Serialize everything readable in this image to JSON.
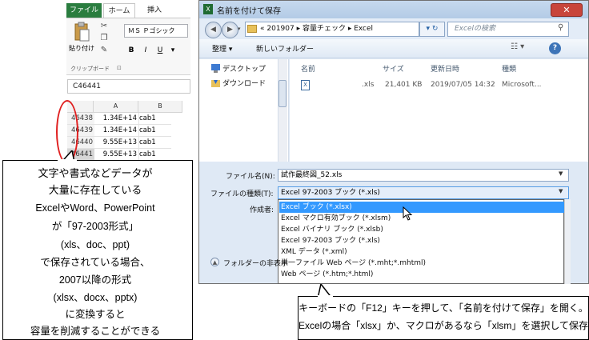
{
  "excel": {
    "tabs": {
      "file": "ファイル",
      "home": "ホーム",
      "insert": "挿入"
    },
    "paste_label": "貼り付け",
    "clipboard_label": "クリップボード",
    "clipboard_launcher": "⊡",
    "font_name": "ＭＳ Ｐゴシック",
    "bold": "B",
    "italic": "I",
    "underline": "U",
    "cell_reference": "C46441",
    "columns": [
      "A",
      "B"
    ],
    "rows": [
      {
        "num": "46438",
        "a": "1.34E+14",
        "b": "cab1"
      },
      {
        "num": "46439",
        "a": "1.34E+14",
        "b": "cab1"
      },
      {
        "num": "46440",
        "a": "9.55E+13",
        "b": "cab1"
      },
      {
        "num": "46441",
        "a": "9.55E+13",
        "b": "cab1"
      }
    ],
    "highlight_color": "#e02020"
  },
  "callout_left": {
    "lines": [
      "文字や書式などデータが",
      "大量に存在している",
      "ExcelやWord、PowerPoint",
      "が「97-2003形式」",
      "(xls、doc、ppt)",
      "で保存されている場合、",
      "2007以降の形式",
      "(xlsx、docx、pptx)",
      "に変換すると",
      "容量を削減することができる"
    ]
  },
  "dialog": {
    "title": "名前を付けて保存",
    "title_icon": "X",
    "close": "✕",
    "breadcrumb": "« 201907 ▸ 容量チェック ▸ Excel",
    "search_placeholder": "Excelの検索",
    "toolbar": {
      "organize": "整理 ▾",
      "new_folder": "新しいフォルダー",
      "view": "☷ ▾",
      "help": "?"
    },
    "nav_items": [
      "デスクトップ",
      "ダウンロード"
    ],
    "columns": {
      "name": "名前",
      "size": "サイズ",
      "modified": "更新日時",
      "type": "種類"
    },
    "file": {
      "ext": ".xls",
      "size": "21,401 KB",
      "modified": "2019/07/05 14:32",
      "type": "Microsoft..."
    },
    "filename_label": "ファイル名(N):",
    "filename_value": "試作最終図_52.xls",
    "filetype_label": "ファイルの種類(T):",
    "filetype_value": "Excel 97-2003 ブック (*.xls)",
    "author_label": "作成者:",
    "hide_folders": "フォルダーの非表示",
    "options": [
      "Excel ブック (*.xlsx)",
      "Excel マクロ有効ブック (*.xlsm)",
      "Excel バイナリ ブック (*.xlsb)",
      "Excel 97-2003 ブック (*.xls)",
      "XML データ (*.xml)",
      "単一ファイル Web ページ (*.mht;*.mhtml)",
      "Web ページ (*.htm;*.html)"
    ],
    "selected_option_color": "#3399ff"
  },
  "callout_bottom": {
    "lines": [
      "キーボードの「F12」キーを押して、「名前を付けて保存」を開く。",
      "Excelの場合「xlsx」か、マクロがあるなら「xlsm」を選択して保存"
    ]
  }
}
